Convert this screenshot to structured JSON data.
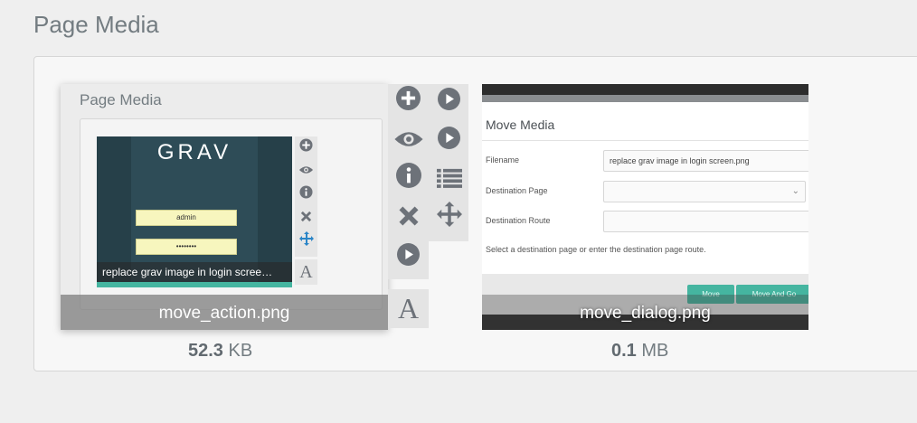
{
  "section_title": "Page Media",
  "files": [
    {
      "filename": "move_action.png",
      "size_value": "52.3",
      "size_unit": "KB",
      "preview": {
        "panel_title": "Page Media",
        "logo": "GRAV",
        "username_field": "admin",
        "password_field": "••••••••",
        "caption": "replace grav image in login scree…",
        "accent_color": "#45b5a0",
        "mini_icons": [
          "plus-circle-icon",
          "eye-icon",
          "info-icon",
          "close-icon",
          "move-icon",
          "text-icon"
        ],
        "mini_text_icon": "A"
      }
    },
    {
      "filename": "move_dialog.png",
      "size_value": "0.1",
      "size_unit": "MB",
      "preview": {
        "dialog_title": "Move Media",
        "filename_label": "Filename",
        "filename_value": "replace grav image in login screen.png",
        "destination_page_label": "Destination Page",
        "destination_route_label": "Destination Route",
        "help_text": "Select a destination page or enter the destination page route.",
        "move_button": "Move",
        "move_and_go_button": "Move And Go"
      }
    }
  ],
  "action_icons": {
    "column_1": [
      "plus-circle-icon",
      "eye-icon",
      "info-icon",
      "close-icon",
      "play-icon"
    ],
    "column_2": [
      "play-icon",
      "play-icon",
      "list-icon",
      "move-icon"
    ],
    "text_icon": "A"
  },
  "colors": {
    "background": "#efefef",
    "text": "#737c81",
    "accent": "#45b5a0",
    "move_icon": "#2a85c7"
  }
}
